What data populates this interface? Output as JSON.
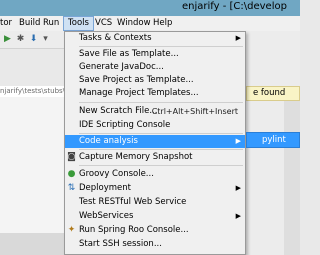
{
  "window": {
    "title": "enjarify - [C:\\develop"
  },
  "menubar": {
    "items": [
      {
        "label": "tor"
      },
      {
        "label": "Build"
      },
      {
        "label": "Run"
      },
      {
        "label": "Tools"
      },
      {
        "label": "VCS"
      },
      {
        "label": "Window"
      },
      {
        "label": "Help"
      }
    ]
  },
  "editor": {
    "path_text": "njarify\\tests\\stubs\\",
    "notice_text": "e found"
  },
  "tools_menu": {
    "items": [
      {
        "label": "Tasks & Contexts",
        "has_submenu": true
      },
      {
        "label": "Save File as Template..."
      },
      {
        "label": "Generate JavaDoc..."
      },
      {
        "label": "Save Project as Template..."
      },
      {
        "label": "Manage Project Templates..."
      },
      {
        "label": "New Scratch File...",
        "shortcut": "Ctrl+Alt+Shift+Insert"
      },
      {
        "label": "IDE Scripting Console"
      },
      {
        "label": "Code analysis",
        "has_submenu": true,
        "highlighted": true
      },
      {
        "label": "Capture Memory Snapshot",
        "icon": "camera-icon"
      },
      {
        "label": "Groovy Console...",
        "icon": "groovy-icon"
      },
      {
        "label": "Deployment",
        "icon": "deployment-icon",
        "has_submenu": true
      },
      {
        "label": "Test RESTful Web Service"
      },
      {
        "label": "WebServices",
        "has_submenu": true
      },
      {
        "label": "Run Spring Roo Console...",
        "icon": "spring-roo-icon"
      },
      {
        "label": "Start SSH session..."
      }
    ]
  },
  "submenu": {
    "items": [
      {
        "label": "pylint"
      }
    ]
  },
  "colors": {
    "highlight": "#3399ff",
    "titlebar": "#70a7c3",
    "notice": "#f9f4c6"
  }
}
